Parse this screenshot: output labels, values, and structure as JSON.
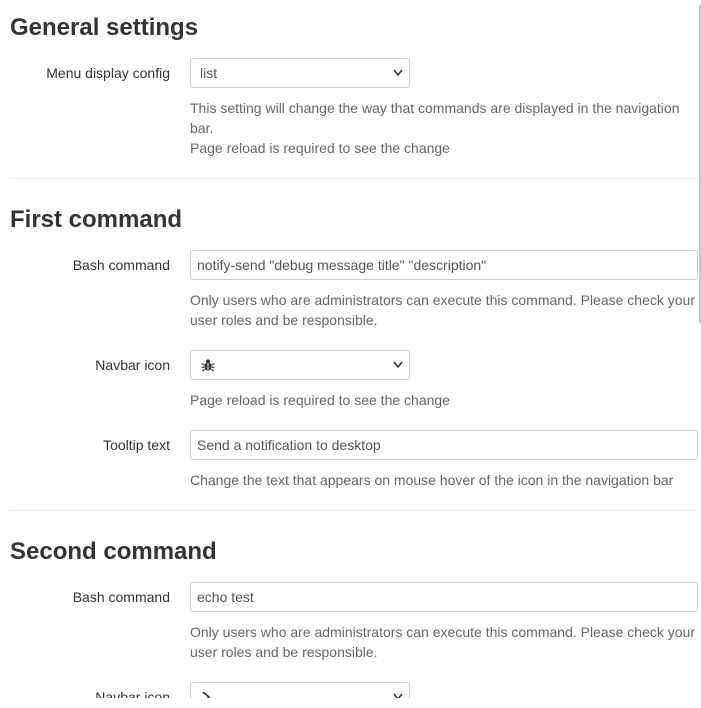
{
  "general": {
    "title": "General settings",
    "menu_display": {
      "label": "Menu display config",
      "value": "list",
      "help_lines": [
        "This setting will change the way that commands are displayed in the navigation bar.",
        "Page reload is required to see the change"
      ]
    }
  },
  "first_command": {
    "title": "First command",
    "bash": {
      "label": "Bash command",
      "value": "notify-send \"debug message title\" \"description\"",
      "help": "Only users who are administrators can execute this command. Please check your user roles and be responsible."
    },
    "navbar_icon": {
      "label": "Navbar icon",
      "icon": "bug-icon",
      "help": "Page reload is required to see the change"
    },
    "tooltip": {
      "label": "Tooltip text",
      "value": "Send a notification to desktop",
      "help": "Change the text that appears on mouse hover of the icon in the navigation bar"
    }
  },
  "second_command": {
    "title": "Second command",
    "bash": {
      "label": "Bash command",
      "value": "echo test",
      "help": "Only users who are administrators can execute this command. Please check your user roles and be responsible."
    },
    "navbar_icon": {
      "label": "Navbar icon",
      "icon": "chevron-right-icon"
    }
  }
}
